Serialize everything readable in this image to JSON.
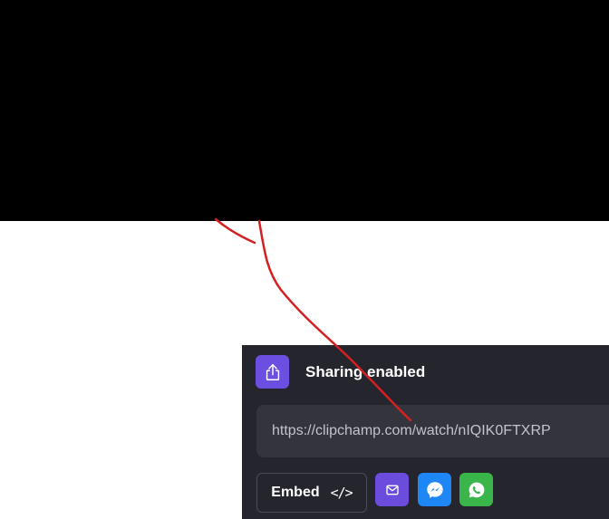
{
  "share_panel": {
    "title": "Sharing enabled",
    "link_url": "https://clipchamp.com/watch/nIQIK0FTXRP",
    "embed_label": "Embed",
    "embed_icon": "</>"
  },
  "icons": {
    "share": "share-icon",
    "email": "email-icon",
    "messenger": "messenger-icon",
    "whatsapp": "whatsapp-icon"
  },
  "colors": {
    "panel_background": "#25252d",
    "accent_purple": "#6c4fe0",
    "messenger_blue": "#1e86f5",
    "whatsapp_green": "#39b54a",
    "annotation_red": "#d42020"
  }
}
